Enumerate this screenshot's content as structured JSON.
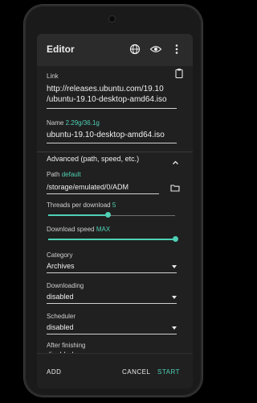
{
  "dialog": {
    "title": "Editor",
    "icons": [
      "globe-icon",
      "eye-icon",
      "more-vert-icon"
    ]
  },
  "link": {
    "label": "Link",
    "url_line1": "http://releases.ubuntu.com/19.10",
    "url_line2": "/ubuntu-19.10-desktop-amd64.iso"
  },
  "name": {
    "label": "Name",
    "size": "2.29g/36.1g",
    "value": "ubuntu-19.10-desktop-amd64.iso"
  },
  "advanced": {
    "label": "Advanced (path, speed, etc.)"
  },
  "path": {
    "label": "Path",
    "tag": "default",
    "value": "/storage/emulated/0/ADM"
  },
  "threads": {
    "label": "Threads per download",
    "value": "5",
    "fraction": 0.47
  },
  "speed": {
    "label": "Download speed",
    "value": "MAX",
    "fraction": 1.0
  },
  "category": {
    "label": "Category",
    "value": "Archives"
  },
  "downloading": {
    "label": "Downloading",
    "value": "disabled"
  },
  "scheduler": {
    "label": "Scheduler",
    "value": "disabled"
  },
  "after": {
    "label": "After finishing",
    "value": "disabled"
  },
  "footer": {
    "add": "ADD",
    "cancel": "CANCEL",
    "start": "START"
  },
  "colors": {
    "accent": "#4fd0b5",
    "dialog_bg": "#202020",
    "titlebar_bg": "#2b2b2b"
  }
}
